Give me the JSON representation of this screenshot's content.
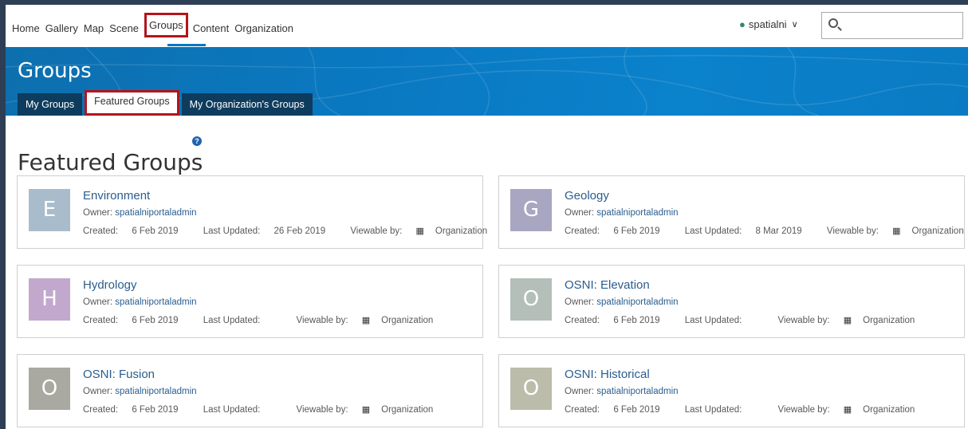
{
  "nav": {
    "links": [
      "Home",
      "Gallery",
      "Map",
      "Scene",
      "Groups",
      "Content",
      "Organization"
    ],
    "active": "Groups",
    "user": "spatialni",
    "search_placeholder": ""
  },
  "banner": {
    "title": "Groups",
    "tabs": [
      "My Groups",
      "Featured Groups",
      "My Organization's Groups"
    ],
    "active_tab": "Featured Groups"
  },
  "page": {
    "heading": "Featured Groups"
  },
  "labels": {
    "owner": "Owner:",
    "created": "Created:",
    "last_updated": "Last Updated:",
    "viewable_by": "Viewable by:"
  },
  "groups": [
    {
      "letter": "E",
      "thumb_color": "#a9bccb",
      "title": "Environment",
      "owner": "spatialniportaladmin",
      "created": "6 Feb 2019",
      "updated": "26 Feb 2019",
      "viewable": "Organization"
    },
    {
      "letter": "G",
      "thumb_color": "#a8a6c1",
      "title": "Geology",
      "owner": "spatialniportaladmin",
      "created": "6 Feb 2019",
      "updated": "8 Mar 2019",
      "viewable": "Organization"
    },
    {
      "letter": "H",
      "thumb_color": "#c2a8cd",
      "title": "Hydrology",
      "owner": "spatialniportaladmin",
      "created": "6 Feb 2019",
      "updated": "",
      "viewable": "Organization"
    },
    {
      "letter": "O",
      "thumb_color": "#b3bfb8",
      "title": "OSNI: Elevation",
      "owner": "spatialniportaladmin",
      "created": "6 Feb 2019",
      "updated": "",
      "viewable": "Organization"
    },
    {
      "letter": "O",
      "thumb_color": "#a9a8a1",
      "title": "OSNI: Fusion",
      "owner": "spatialniportaladmin",
      "created": "6 Feb 2019",
      "updated": "",
      "viewable": "Organization"
    },
    {
      "letter": "O",
      "thumb_color": "#bcbcab",
      "title": "OSNI: Historical",
      "owner": "spatialniportaladmin",
      "created": "6 Feb 2019",
      "updated": "",
      "viewable": "Organization"
    }
  ]
}
